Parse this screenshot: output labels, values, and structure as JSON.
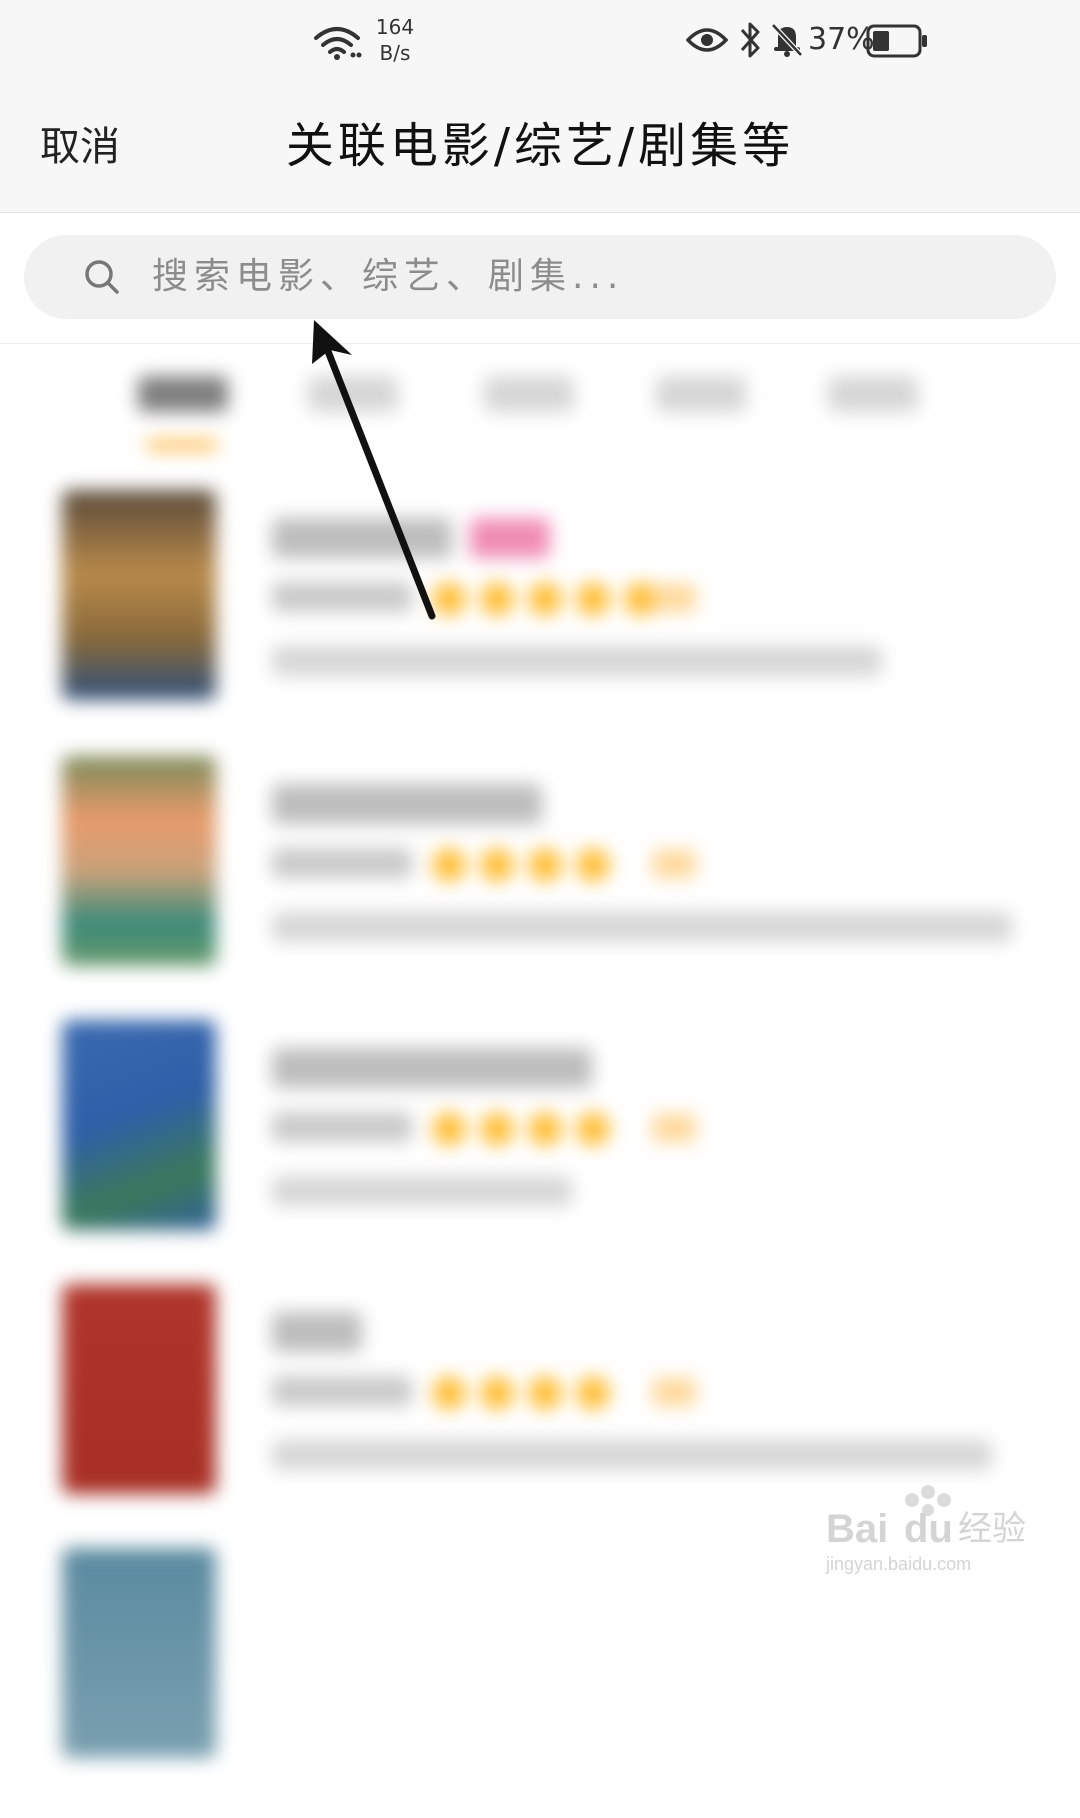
{
  "status_bar": {
    "net_speed_value": "164",
    "net_speed_unit": "B/s",
    "battery_percent": "37%"
  },
  "header": {
    "cancel_label": "取消",
    "title": "关联电影/综艺/剧集等"
  },
  "search": {
    "placeholder": "搜索电影、综艺、剧集..."
  },
  "watermark": {
    "brand": "Baidu经验",
    "url": "jingyan.baidu.com"
  },
  "colors": {
    "accent": "#ffb640",
    "star": "#ffbf3a",
    "search_bg": "#f1f1f1",
    "arrow": "#111111"
  }
}
